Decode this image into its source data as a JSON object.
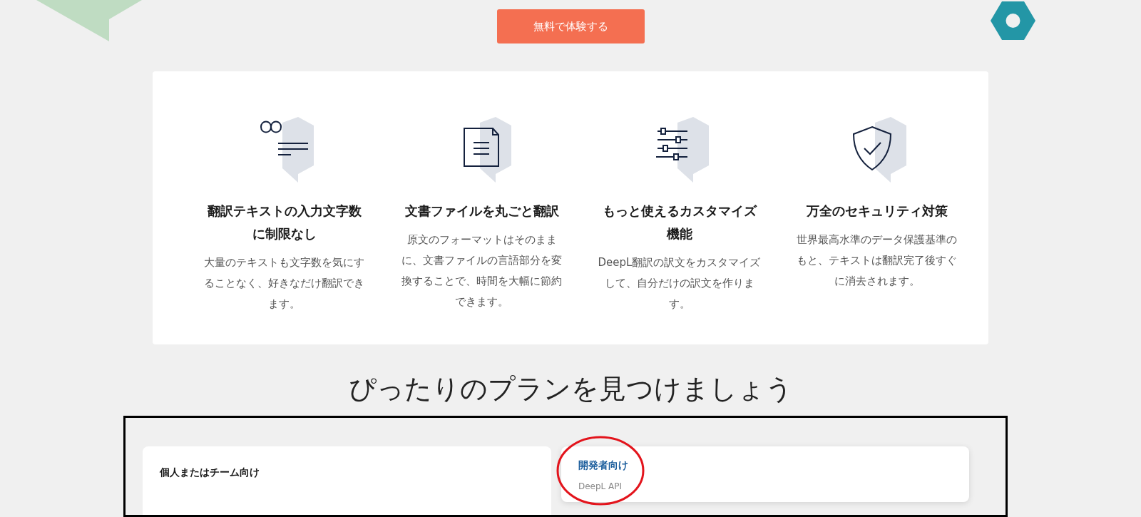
{
  "cta_button": {
    "label": "無料で体験する"
  },
  "features": [
    {
      "title": "翻訳テキストの入力文字数に制限なし",
      "description": "大量のテキストも文字数を気にすることなく、好きなだけ翻訳できます。"
    },
    {
      "title": "文書ファイルを丸ごと翻訳",
      "description": "原文のフォーマットはそのままに、文書ファイルの言語部分を変換することで、時間を大幅に節約できます。"
    },
    {
      "title": "もっと使えるカスタマイズ機能",
      "description": "DeepL翻訳の訳文をカスタマイズして、自分だけの訳文を作ります。"
    },
    {
      "title": "万全のセキュリティ対策",
      "description": "世界最高水準のデータ保護基準のもと、テキストは翻訳完了後すぐに消去されます。"
    }
  ],
  "plans_heading": "ぴったりのプランを見つけましょう",
  "plan_tabs": [
    {
      "title": "個人またはチーム向け",
      "selected": true
    },
    {
      "title": "開発者向け",
      "subtitle": "DeepL API",
      "selected": false
    }
  ]
}
